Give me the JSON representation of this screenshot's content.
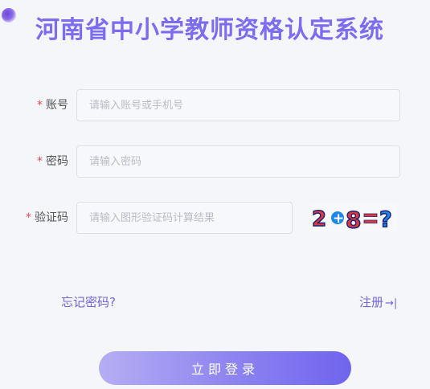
{
  "header": {
    "title": "河南省中小学教师资格认定系统"
  },
  "form": {
    "required_mark": "*",
    "account": {
      "label": "账号",
      "placeholder": "请输入账号或手机号",
      "value": ""
    },
    "password": {
      "label": "密码",
      "placeholder": "请输入密码",
      "value": ""
    },
    "captcha": {
      "label": "验证码",
      "placeholder": "请输入图形验证码计算结果",
      "value": "",
      "image_text": "2+8=?"
    }
  },
  "links": {
    "forgot": "忘记密码?",
    "register": "注册"
  },
  "login_button": "立即登录",
  "colors": {
    "accent": "#7d6cf0",
    "required": "#e4484f",
    "link": "#7263d6"
  }
}
